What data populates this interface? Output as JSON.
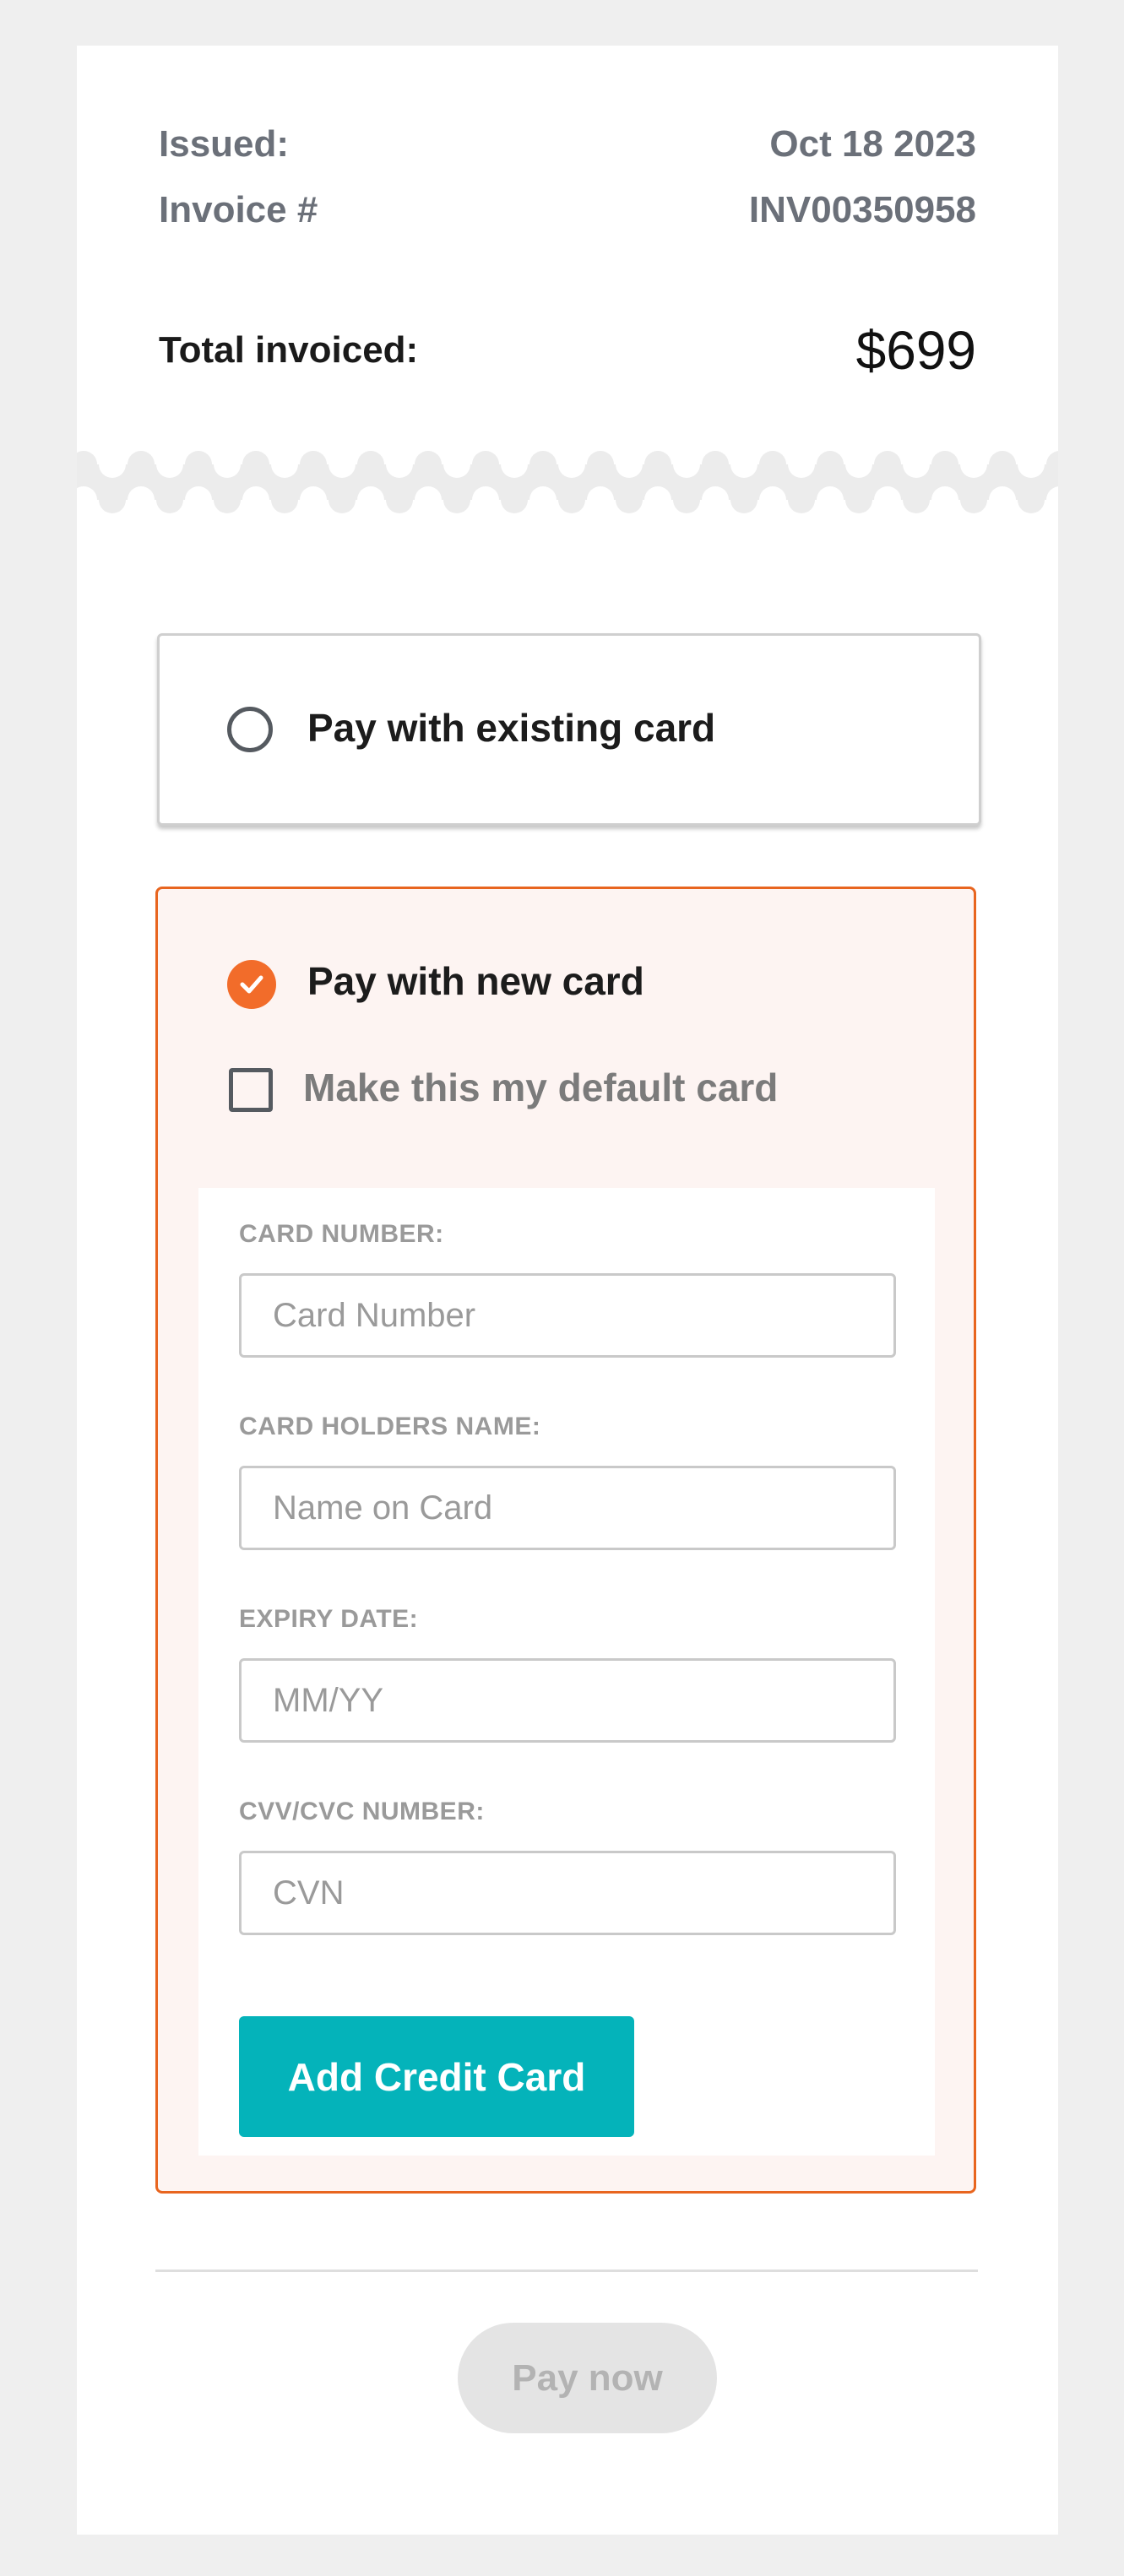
{
  "invoice": {
    "issued_label": "Issued:",
    "issued_value": "Oct 18 2023",
    "invoice_label": "Invoice #",
    "invoice_value": "INV00350958",
    "total_label": "Total invoiced:",
    "total_value": "$699"
  },
  "payment_options": {
    "existing_label": "Pay with existing card",
    "new_label": "Pay with new card",
    "selected": "new",
    "default_card_label": "Make this my default card",
    "default_card_checked": false
  },
  "card_form": {
    "card_number_label": "CARD NUMBER:",
    "card_number_placeholder": "Card Number",
    "holder_label": "CARD HOLDERS NAME:",
    "holder_placeholder": "Name on Card",
    "expiry_label": "EXPIRY DATE:",
    "expiry_placeholder": "MM/YY",
    "cvv_label": "CVV/CVC NUMBER:",
    "cvv_placeholder": "CVN",
    "submit_label": "Add Credit Card"
  },
  "footer": {
    "pay_label": "Pay now"
  },
  "icons": {
    "existing_radio": "radio-unchecked-icon",
    "new_radio": "radio-checked-icon",
    "default_checkbox": "checkbox-unchecked-icon"
  },
  "colors": {
    "accent": "#f26c2a",
    "selected_bg": "#fdf4f2",
    "button": "#04b3ba",
    "disabled_button": "#e4e4e4"
  }
}
